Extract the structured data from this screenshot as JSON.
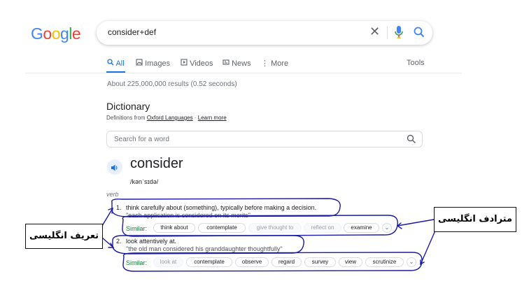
{
  "logo": {
    "text": "Google",
    "letters": [
      "G",
      "o",
      "o",
      "g",
      "l",
      "e"
    ],
    "colors": [
      "#4285F4",
      "#EA4335",
      "#FBBC05",
      "#4285F4",
      "#34A853",
      "#EA4335"
    ]
  },
  "search": {
    "query": "consider+def",
    "clear_icon": "close-icon",
    "mic_icon": "mic-icon",
    "search_icon": "search-icon"
  },
  "tabs": [
    {
      "label": "All",
      "icon": "search-icon",
      "active": true
    },
    {
      "label": "Images",
      "icon": "image-icon",
      "active": false
    },
    {
      "label": "Videos",
      "icon": "video-icon",
      "active": false
    },
    {
      "label": "News",
      "icon": "news-icon",
      "active": false
    },
    {
      "label": "More",
      "icon": "more-vert-icon",
      "active": false
    }
  ],
  "tools_label": "Tools",
  "result_stats": "About 225,000,000 results (0.52 seconds)",
  "dictionary": {
    "title": "Dictionary",
    "source_prefix": "Definitions from",
    "source_link": "Oxford Languages",
    "separator": " · ",
    "learn_more": "Learn more",
    "word_search_placeholder": "Search for a word",
    "word": "consider",
    "phonetic": "/kənˈsɪdə/",
    "part_of_speech": "verb",
    "senses": [
      {
        "number": "1.",
        "definition": "think carefully about (something), typically before making a decision.",
        "example": "\"each application is considered on its merits\"",
        "similar_label": "Similar:",
        "similar": [
          {
            "text": "think about",
            "dim": false
          },
          {
            "text": "contemplate",
            "dim": false
          },
          {
            "text": "give thought to",
            "dim": true
          },
          {
            "text": "reflect on",
            "dim": true
          },
          {
            "text": "examine",
            "dim": false
          }
        ]
      },
      {
        "number": "2.",
        "definition": "look attentively at.",
        "example": "\"the old man considered his granddaughter thoughtfully\"",
        "similar_label": "Similar:",
        "similar": [
          {
            "text": "look at",
            "dim": true
          },
          {
            "text": "contemplate",
            "dim": false
          },
          {
            "text": "observe",
            "dim": false
          },
          {
            "text": "regard",
            "dim": false
          },
          {
            "text": "survey",
            "dim": false
          },
          {
            "text": "view",
            "dim": false
          },
          {
            "text": "scrutinize",
            "dim": false
          }
        ]
      }
    ]
  },
  "annotations": {
    "definition_callout": "تعریف انگلیسی",
    "synonym_callout": "مترادف انگلیسی",
    "highlight_color": "#1a1aa6"
  }
}
